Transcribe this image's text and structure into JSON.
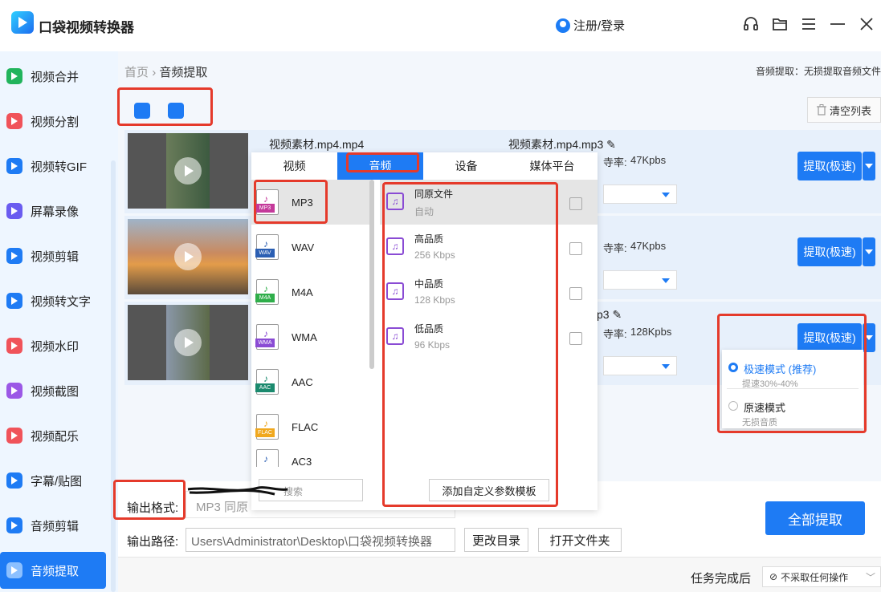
{
  "app": {
    "title": "口袋视频转换器",
    "login": "注册/登录"
  },
  "sidebar": {
    "items": [
      {
        "label": "视频合并",
        "color": "#21b45c"
      },
      {
        "label": "视频分割",
        "color": "#f0535a"
      },
      {
        "label": "视频转GIF",
        "color": "#1e7bf4"
      },
      {
        "label": "屏幕录像",
        "color": "#6a5cf0"
      },
      {
        "label": "视频剪辑",
        "color": "#1e7bf4"
      },
      {
        "label": "视频转文字",
        "color": "#1e7bf4"
      },
      {
        "label": "视频水印",
        "color": "#f0535a"
      },
      {
        "label": "视频截图",
        "color": "#9b58e6"
      },
      {
        "label": "视频配乐",
        "color": "#f0535a"
      },
      {
        "label": "字幕/贴图",
        "color": "#1e7bf4"
      },
      {
        "label": "音频剪辑",
        "color": "#1e7bf4"
      },
      {
        "label": "音频提取",
        "color": "#ffffff",
        "active": true
      }
    ]
  },
  "breadcrumb": {
    "home": "首页",
    "sep": "›",
    "current": "音频提取",
    "right_info": "音频提取：无损提取音频文件"
  },
  "toolbar": {
    "clear_list": "清空列表"
  },
  "files": [
    {
      "src": "视频素材.mp4.mp4",
      "out": "视频素材.mp4.mp3",
      "bitrate_label": "寺率:",
      "bitrate": "47Kpbs",
      "extract": "提取(极速)"
    },
    {
      "src": "",
      "out": "",
      "bitrate_label": "寺率:",
      "bitrate": "47Kpbs",
      "extract": "提取(极速)"
    },
    {
      "src": "",
      "out": "p3",
      "bitrate_label": "寺率:",
      "bitrate": "128Kpbs",
      "extract": "提取(极速)"
    }
  ],
  "format_panel": {
    "tabs": [
      "视频",
      "音频",
      "设备",
      "媒体平台"
    ],
    "formats": [
      {
        "name": "MP3",
        "tag": "MP3",
        "color": "#c4399a"
      },
      {
        "name": "WAV",
        "tag": "WAV",
        "color": "#2b5fb3"
      },
      {
        "name": "M4A",
        "tag": "M4A",
        "color": "#2fae4a"
      },
      {
        "name": "WMA",
        "tag": "WMA",
        "color": "#8a4bd4"
      },
      {
        "name": "AAC",
        "tag": "AAC",
        "color": "#1b8a6e"
      },
      {
        "name": "FLAC",
        "tag": "FLAC",
        "color": "#f0a81e"
      },
      {
        "name": "AC3",
        "tag": "",
        "color": "#2b5fb3"
      }
    ],
    "qualities": [
      {
        "name": "同原文件",
        "sub": "自动"
      },
      {
        "name": "高品质",
        "sub": "256 Kbps"
      },
      {
        "name": "中品质",
        "sub": "128 Kbps"
      },
      {
        "name": "低品质",
        "sub": "96 Kbps"
      }
    ],
    "search_placeholder": "搜索",
    "custom_btn": "添加自定义参数模板"
  },
  "mode_dropdown": {
    "options": [
      {
        "name": "极速模式 (推荐)",
        "sub": "提速30%-40%",
        "checked": true
      },
      {
        "name": "原速模式",
        "sub": "无损音质",
        "checked": false
      }
    ]
  },
  "bottom": {
    "output_format_label": "输出格式:",
    "output_format_value": "MP3  同原",
    "output_path_label": "输出路径:",
    "output_path_value": "Users\\Administrator\\Desktop\\口袋视频转换器",
    "change_dir": "更改目录",
    "open_folder": "打开文件夹",
    "extract_all": "全部提取",
    "after_task_label": "任务完成后",
    "after_task_value": "不采取任何操作"
  }
}
